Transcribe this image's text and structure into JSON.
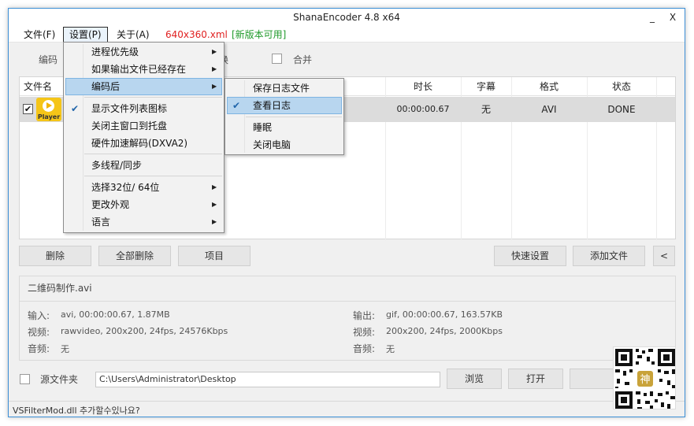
{
  "window": {
    "title": "ShanaEncoder 4.8 x64",
    "min_glyph": "_",
    "close_glyph": "X"
  },
  "menubar": {
    "file": "文件(F)",
    "settings": "设置(P)",
    "about": "关于(A)",
    "resolution": "640x360.xml",
    "new_version": "[新版本可用]"
  },
  "toolbar": {
    "encoder_label": "编码",
    "options_label": "换",
    "merge_label": "合并"
  },
  "settings_menu": {
    "items": [
      {
        "label": "进程优先级",
        "submenu": true
      },
      {
        "label": "如果输出文件已经存在",
        "submenu": true
      },
      {
        "label": "编码后",
        "submenu": true,
        "highlighted": true
      },
      {
        "label": "显示文件列表图标",
        "checked": true
      },
      {
        "label": "关闭主窗口到托盘"
      },
      {
        "label": "硬件加速解码(DXVA2)"
      },
      {
        "label": "多线程/同步"
      },
      {
        "label": "选择32位/ 64位",
        "submenu": true
      },
      {
        "label": "更改外观",
        "submenu": true
      },
      {
        "label": "语言",
        "submenu": true
      }
    ]
  },
  "after_encode_menu": {
    "items": [
      {
        "label": "保存日志文件"
      },
      {
        "label": "查看日志",
        "checked": true,
        "highlighted": true
      },
      {
        "label": "睡眠"
      },
      {
        "label": "关闭电脑"
      }
    ]
  },
  "file_table": {
    "columns": [
      "文件名",
      "时长",
      "字幕",
      "格式",
      "状态"
    ],
    "rows": [
      {
        "checked": true,
        "icon_label": "Player",
        "duration": "00:00:00.67",
        "subtitle": "无",
        "format": "AVI",
        "status": "DONE"
      }
    ]
  },
  "buttons": {
    "delete": "删除",
    "delete_all": "全部删除",
    "item": "项目",
    "quick_settings": "快速设置",
    "add_file": "添加文件",
    "collapse": "<",
    "browse": "浏览",
    "open": "打开"
  },
  "info": {
    "filename": "二维码制作.avi",
    "input_label": "输入:",
    "input_value": "avi, 00:00:00.67, 1.87MB",
    "video_label": "视频:",
    "video_in_value": "rawvideo, 200x200, 24fps, 24576Kbps",
    "audio_label": "音频:",
    "audio_in_value": "无",
    "output_label": "输出:",
    "output_value": "gif, 00:00:00.67, 163.57KB",
    "video_out_value": "200x200, 24fps, 2000Kbps",
    "audio_out_value": "无"
  },
  "source": {
    "label": "源文件夹",
    "path": "C:\\Users\\Administrator\\Desktop"
  },
  "status": {
    "text": "VSFilterMod.dll 추가할수있나요?"
  },
  "icons": {
    "checkmark": "✔",
    "submenu_arrow": "▶",
    "qr_center_glyph": "神"
  }
}
